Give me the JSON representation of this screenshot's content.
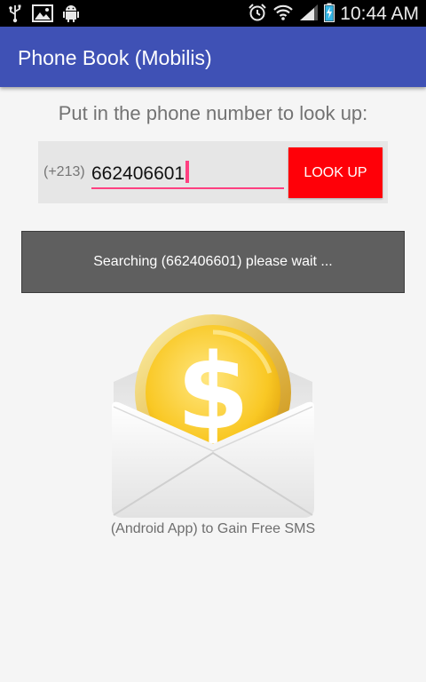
{
  "status_bar": {
    "time": "10:44 AM",
    "icons": [
      "usb-icon",
      "image-icon",
      "android-debug-icon",
      "alarm-icon",
      "wifi-icon",
      "signal-icon",
      "battery-charging-icon"
    ]
  },
  "app_bar": {
    "title": "Phone Book (Mobilis)"
  },
  "lookup": {
    "prompt": "Put in the phone number to look up:",
    "country_prefix": "(+213)",
    "phone_value": "662406601",
    "button_label": "LOOK UP"
  },
  "status": {
    "message": "Searching (662406601) please wait ..."
  },
  "promo": {
    "caption": "(Android App) to Gain Free SMS",
    "icon": "dollar-envelope-icon"
  },
  "colors": {
    "app_bar": "#3f51b5",
    "accent": "#ff4081",
    "lookup_button": "#ff0008",
    "status_box": "#5f5f5f"
  }
}
